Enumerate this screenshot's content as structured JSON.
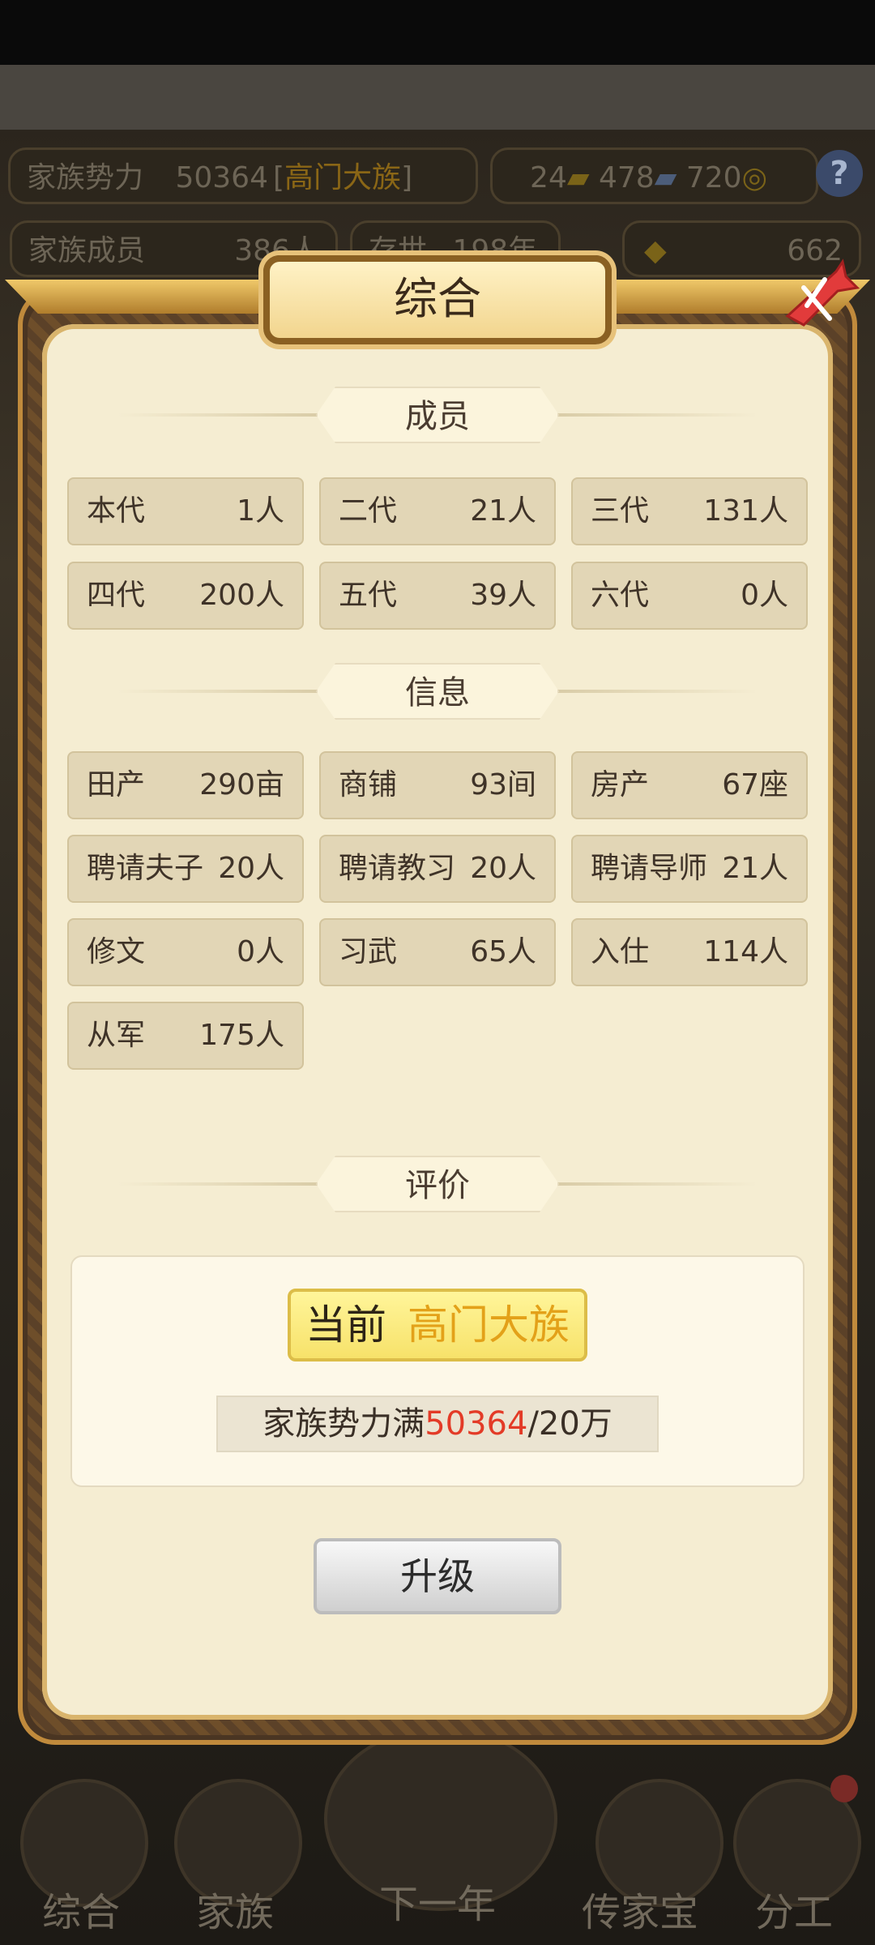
{
  "hud": {
    "power_label": "家族势力",
    "power_value": "50364",
    "power_rank_open": "[",
    "power_rank": "高门大族",
    "power_rank_close": "]",
    "res1": "24",
    "res2": "478",
    "res3": "720",
    "members_label": "家族成员",
    "members_value": "386人",
    "exist_label": "存世",
    "exist_value": "198年",
    "ingot": "662"
  },
  "dialog": {
    "title": "综合",
    "section_members": "成员",
    "generations": [
      {
        "k": "本代",
        "v": "1人"
      },
      {
        "k": "二代",
        "v": "21人"
      },
      {
        "k": "三代",
        "v": "131人"
      },
      {
        "k": "四代",
        "v": "200人"
      },
      {
        "k": "五代",
        "v": "39人"
      },
      {
        "k": "六代",
        "v": "0人"
      }
    ],
    "section_info": "信息",
    "info": [
      {
        "k": "田产",
        "v": "290亩"
      },
      {
        "k": "商铺",
        "v": "93间"
      },
      {
        "k": "房产",
        "v": "67座"
      },
      {
        "k": "聘请夫子",
        "v": "20人"
      },
      {
        "k": "聘请教习",
        "v": "20人"
      },
      {
        "k": "聘请导师",
        "v": "21人"
      },
      {
        "k": "修文",
        "v": "0人"
      },
      {
        "k": "习武",
        "v": "65人"
      },
      {
        "k": "入仕",
        "v": "114人"
      },
      {
        "k": "从军",
        "v": "175人"
      }
    ],
    "section_eval": "评价",
    "current_label": "当前",
    "current_rank": "高门大族",
    "power_prefix": "家族势力满",
    "power_current": "50364",
    "power_target": "/20万",
    "upgrade_label": "升级"
  },
  "bottom_nav": [
    "综合",
    "家族",
    "下一年",
    "传家宝",
    "分工"
  ],
  "colors": {
    "accent_red": "#e33b27",
    "rank_gold": "#e3a119",
    "panel": "#f5edd2"
  }
}
